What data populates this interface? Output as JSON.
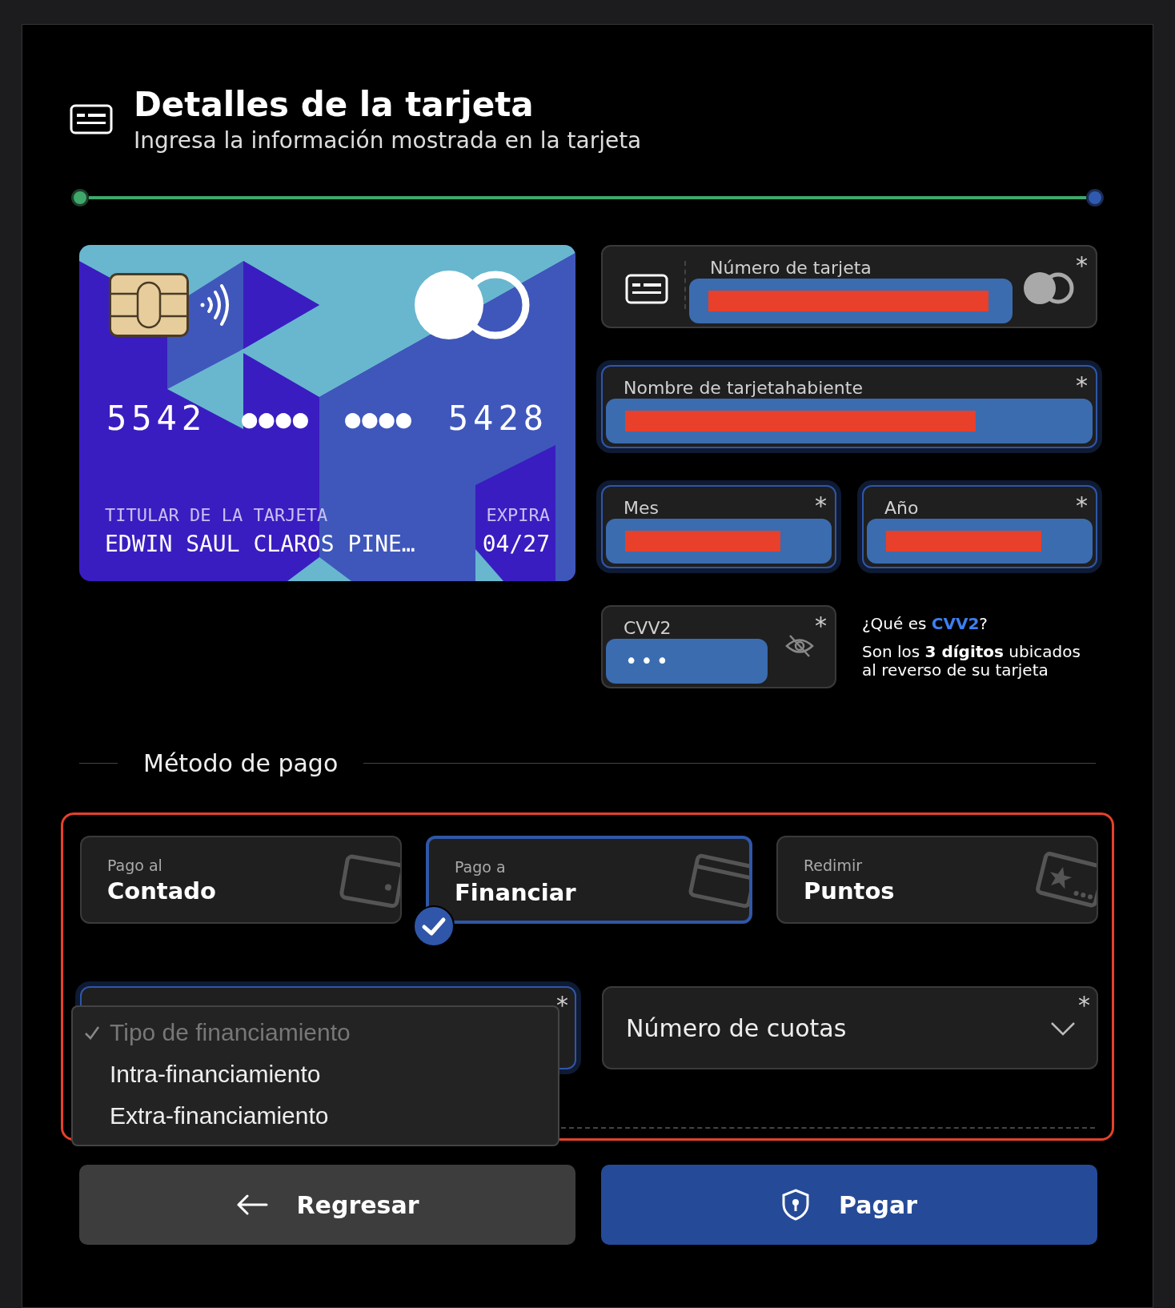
{
  "header": {
    "title": "Detalles de la tarjeta",
    "subtitle": "Ingresa la información mostrada en la tarjeta"
  },
  "card": {
    "number_groups": [
      "5542",
      "●●●●",
      "●●●●",
      "5428"
    ],
    "holder_label": "TITULAR DE LA TARJETA",
    "holder": "EDWIN SAUL CLAROS PINE…",
    "expiry_label": "EXPIRA",
    "expiry": "04/27"
  },
  "fields": [
    {
      "kind": "card_number",
      "label": "Número de tarjeta",
      "required_mark": "*",
      "focused": false,
      "redacted": true
    },
    {
      "kind": "text",
      "label": "Nombre de tarjetahabiente",
      "required_mark": "*",
      "focused": true,
      "redacted": true
    },
    {
      "kind": "text",
      "label": "Mes",
      "required_mark": "*",
      "focused": true,
      "redacted": true
    },
    {
      "kind": "text",
      "label": "Año",
      "required_mark": "*",
      "focused": true,
      "redacted": true
    },
    {
      "kind": "secret",
      "label": "CVV2",
      "value": "•••",
      "required_mark": "*",
      "focused": false,
      "redacted": false
    }
  ],
  "cvv_help": {
    "question": "¿Qué es **CVV2**?",
    "answer": "Son los **3 dígitos** ubicados al reverso de su tarjeta"
  },
  "payment": {
    "title": "Método de pago",
    "highlighted": true,
    "methods": [
      {
        "caption": "Pago al",
        "label": "Contado",
        "selected": false
      },
      {
        "caption": "Pago a",
        "label": "Financiar",
        "selected": true
      },
      {
        "caption": "Redimir",
        "label": "Puntos",
        "selected": false
      }
    ],
    "selects": [
      {
        "required_mark": "*",
        "focused": true,
        "open": true,
        "options": [
          {
            "label": "Tipo de financiamiento",
            "selected": true,
            "disabled": true
          },
          {
            "label": "Intra-financiamiento",
            "selected": false,
            "disabled": false
          },
          {
            "label": "Extra-financiamiento",
            "selected": false,
            "disabled": false
          }
        ]
      },
      {
        "placeholder": "Número de cuotas",
        "required_mark": "*",
        "focused": false,
        "open": false
      }
    ]
  },
  "buttons": [
    {
      "kind": "secondary",
      "label": "Regresar"
    },
    {
      "kind": "primary",
      "label": "Pagar"
    }
  ]
}
